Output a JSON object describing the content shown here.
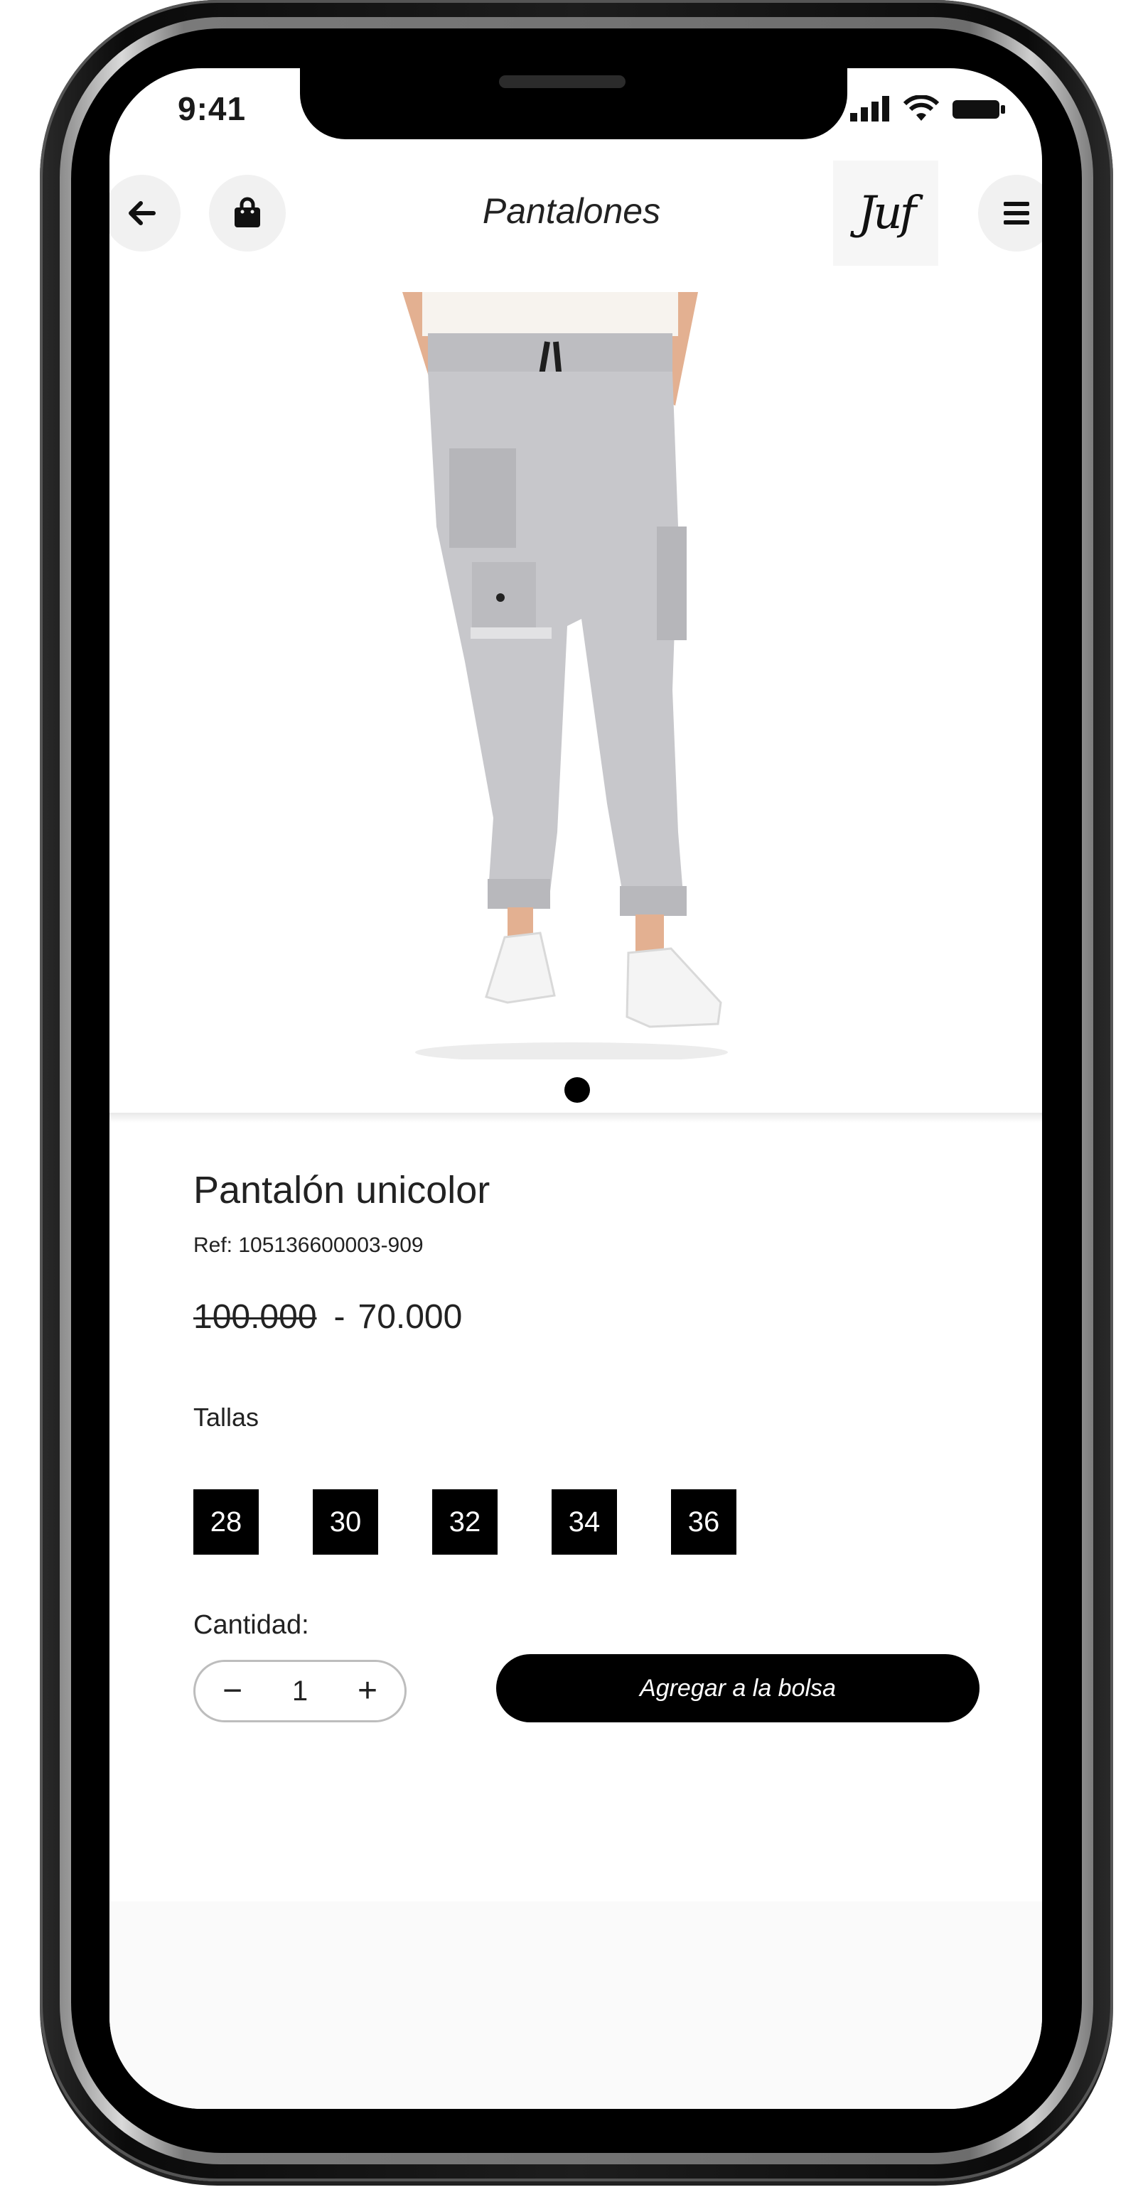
{
  "status_bar": {
    "time": "9:41"
  },
  "header": {
    "title": "Pantalones",
    "logo_text": "Juf",
    "icons": [
      "arrow-left-icon",
      "shopping-bag-icon",
      "hamburger-menu-icon"
    ]
  },
  "product": {
    "name": "Pantalón unicolor",
    "ref": "Ref: 105136600003-909",
    "price_old": "100.000",
    "price_separator": "-",
    "price_new": "70.000",
    "image_count": 1
  },
  "sizes": {
    "label": "Tallas",
    "options": [
      "28",
      "30",
      "32",
      "34",
      "36"
    ]
  },
  "quantity": {
    "label": "Cantidad:",
    "value": "1",
    "minus": "−",
    "plus": "+"
  },
  "actions": {
    "add_to_bag_label": "Agregar a la bolsa"
  },
  "colors": {
    "primary": "#000000",
    "background": "#ffffff",
    "chip_text": "#ffffff"
  }
}
